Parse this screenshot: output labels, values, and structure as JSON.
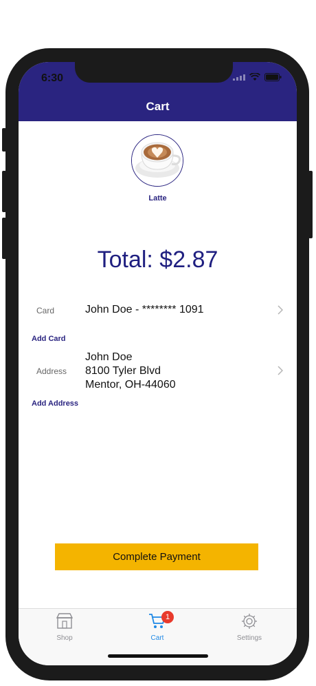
{
  "status_bar": {
    "time": "6:30"
  },
  "nav": {
    "title": "Cart"
  },
  "product": {
    "name": "Latte"
  },
  "summary": {
    "total": "Total: $2.87"
  },
  "card": {
    "label": "Card",
    "value": "John Doe - ******** 1091",
    "add_label": "Add Card"
  },
  "address": {
    "label": "Address",
    "line1": "John Doe",
    "line2": "8100 Tyler Blvd",
    "line3": "Mentor, OH-44060",
    "add_label": "Add Address"
  },
  "actions": {
    "pay_label": "Complete Payment"
  },
  "tabs": [
    {
      "label": "Shop",
      "icon": "store-icon",
      "active": false
    },
    {
      "label": "Cart",
      "icon": "cart-icon",
      "active": true,
      "badge": "1"
    },
    {
      "label": "Settings",
      "icon": "gear-icon",
      "active": false
    }
  ],
  "colors": {
    "header": "#2a2480",
    "accent": "#2a2480",
    "button": "#f4b400",
    "tab_active": "#1e88e5",
    "badge": "#e83a2c"
  }
}
